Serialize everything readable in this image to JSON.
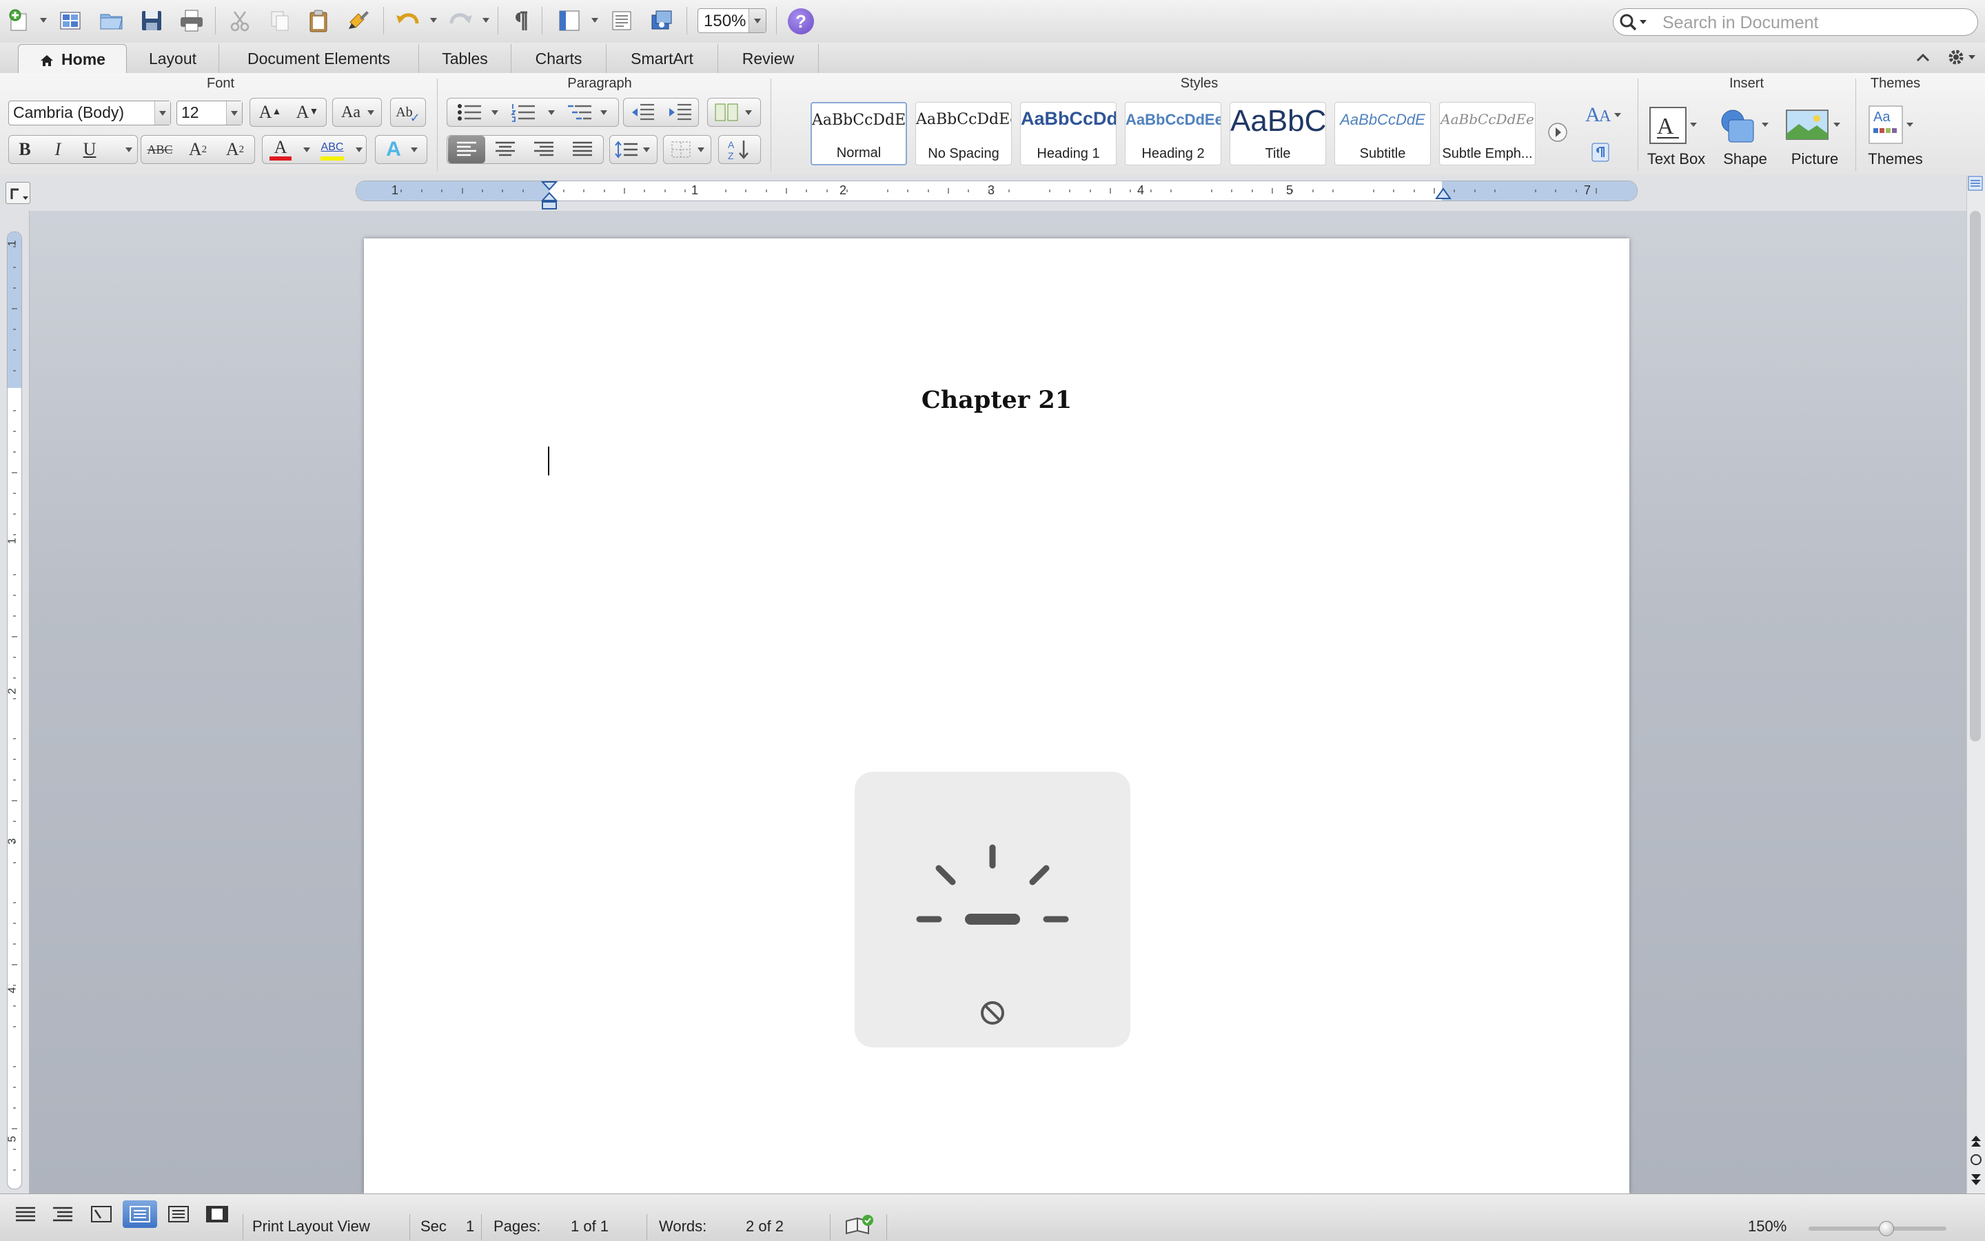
{
  "toolbar": {
    "zoom_value": "150%",
    "help_label": "?",
    "search_placeholder": "Search in Document"
  },
  "tabs": [
    {
      "label": "Home",
      "active": true
    },
    {
      "label": "Layout"
    },
    {
      "label": "Document Elements"
    },
    {
      "label": "Tables"
    },
    {
      "label": "Charts"
    },
    {
      "label": "SmartArt"
    },
    {
      "label": "Review"
    }
  ],
  "ribbon": {
    "font_group_title": "Font",
    "paragraph_group_title": "Paragraph",
    "styles_group_title": "Styles",
    "insert_group_title": "Insert",
    "themes_group_title": "Themes",
    "font_name": "Cambria (Body)",
    "font_size": "12",
    "bold": "B",
    "italic": "I",
    "underline": "U",
    "strikethrough": "ABC",
    "superscript_base": "A",
    "superscript_mark": "2",
    "subscript_base": "A",
    "subscript_mark": "2",
    "font_color_glyph": "A",
    "highlight_glyph": "ABC",
    "text_effects_glyph": "A",
    "grow_font_glyph": "A",
    "shrink_font_glyph": "A",
    "change_case_glyph": "Aa",
    "clear_format_glyph": "Ab",
    "font_color": "#e0191e",
    "highlight_color": "#f5f200",
    "styles": [
      {
        "sample": "AaBbCcDdEe",
        "name": "Normal",
        "selected": true
      },
      {
        "sample": "AaBbCcDdEe",
        "name": "No Spacing"
      },
      {
        "sample": "AaBbCcDd",
        "name": "Heading 1"
      },
      {
        "sample": "AaBbCcDdEe",
        "name": "Heading 2"
      },
      {
        "sample": "AaBbC",
        "name": "Title"
      },
      {
        "sample": "AaBbCcDdE",
        "name": "Subtitle"
      },
      {
        "sample": "AaBbCcDdEe",
        "name": "Subtle Emph..."
      }
    ],
    "insert": {
      "text_box": "Text Box",
      "shape": "Shape",
      "picture": "Picture"
    },
    "themes_label": "Themes",
    "themes_icon_text": "Aa"
  },
  "rulers": {
    "horizontal": [
      "1",
      "1",
      "2",
      "3",
      "4",
      "5",
      "7"
    ],
    "vertical": [
      "1",
      "1",
      "2",
      "3",
      "4",
      "5"
    ]
  },
  "document": {
    "heading": "Chapter 21"
  },
  "statusbar": {
    "view_name": "Print Layout View",
    "sec_label": "Sec",
    "sec_value": "1",
    "pages_label": "Pages:",
    "pages_value": "1 of 1",
    "words_label": "Words:",
    "words_value": "2 of 2",
    "zoom_value": "150%",
    "zoom_level": 0.5
  },
  "colors": {
    "accent": "#3f74c6",
    "heading_style_blue": "#2f5597"
  }
}
